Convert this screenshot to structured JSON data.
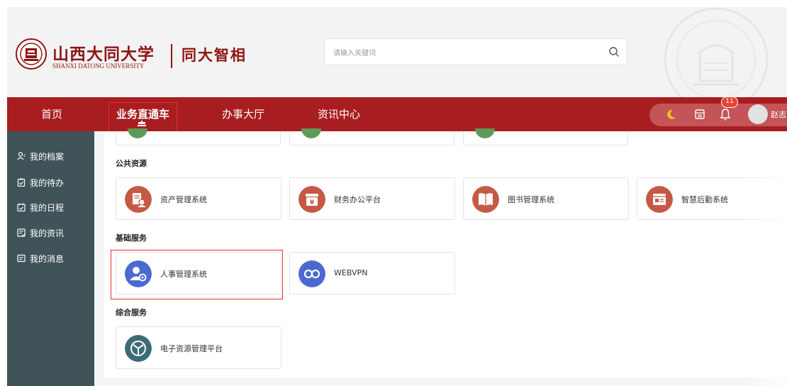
{
  "header": {
    "logo_cn": "山西大同大学",
    "logo_en": "SHANXI DATONG UNIVERSITY",
    "portal_name": "同大智相",
    "search": {
      "placeholder": "请输入关键词"
    }
  },
  "nav": {
    "items": [
      "首页",
      "业务直通车",
      "办事大厅",
      "资讯中心"
    ],
    "active": "业务直通车",
    "notification_count": "11",
    "user_name": "赵志"
  },
  "sidebar": {
    "items": [
      {
        "label": "我的档案",
        "icon": "user-profile-icon"
      },
      {
        "label": "我的待办",
        "icon": "clipboard-check-icon"
      },
      {
        "label": "我的日程",
        "icon": "calendar-check-icon"
      },
      {
        "label": "我的资讯",
        "icon": "news-icon"
      },
      {
        "label": "我的消息",
        "icon": "message-icon"
      }
    ]
  },
  "sections": [
    {
      "title": "公共资源",
      "cards": [
        {
          "label": "资产管理系统",
          "icon": "asset-icon",
          "color": "#c45a45"
        },
        {
          "label": "财务办公平台",
          "icon": "finance-icon",
          "color": "#c45a45"
        },
        {
          "label": "图书管理系统",
          "icon": "book-icon",
          "color": "#c45a45"
        },
        {
          "label": "智慧后勤系统",
          "icon": "logistics-icon",
          "color": "#c45a45"
        }
      ]
    },
    {
      "title": "基础服务",
      "cards": [
        {
          "label": "人事管理系统",
          "icon": "personnel-icon",
          "color": "#4a6ad0"
        },
        {
          "label": "WEBVPN",
          "icon": "vpn-icon",
          "color": "#4a6ad0"
        }
      ]
    },
    {
      "title": "综合服务",
      "cards": [
        {
          "label": "电子资源管理平台",
          "icon": "resource-icon",
          "color": "#3c6c76"
        }
      ]
    }
  ],
  "colors": {
    "brand_red": "#a81d20",
    "sidebar": "#3f5359",
    "highlight": "#e53030"
  }
}
